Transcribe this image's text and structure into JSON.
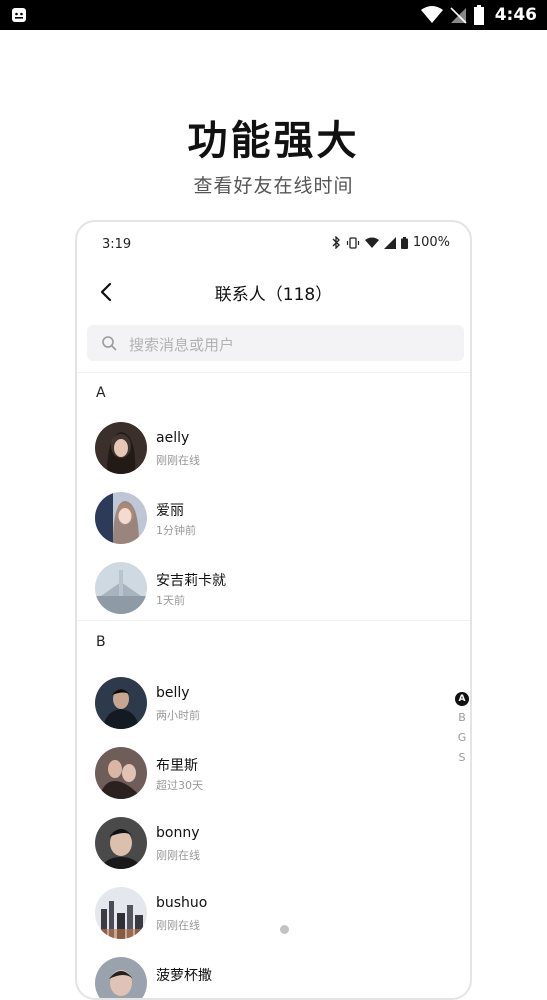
{
  "status_bar": {
    "time": "4:46",
    "icons": [
      "notification-icon",
      "wifi-icon",
      "no-signal-icon",
      "battery-icon"
    ]
  },
  "headline": "功能强大",
  "subline": "查看好友在线时间",
  "phone": {
    "status": {
      "time": "3:19",
      "battery": "100%"
    },
    "nav": {
      "title": "联系人（118）"
    },
    "search": {
      "placeholder": "搜索消息或用户"
    },
    "sections": [
      {
        "letter": "A",
        "contacts": [
          {
            "name": "aelly",
            "status": "刚刚在线"
          },
          {
            "name": "爱丽",
            "status": "1分钟前"
          },
          {
            "name": "安吉莉卡就",
            "status": "1天前"
          }
        ]
      },
      {
        "letter": "B",
        "contacts": [
          {
            "name": "belly",
            "status": "两小时前"
          },
          {
            "name": "布里斯",
            "status": "超过30天"
          },
          {
            "name": "bonny",
            "status": "刚刚在线"
          },
          {
            "name": "bushuo",
            "status": "刚刚在线"
          },
          {
            "name": "菠萝杯撒",
            "status": ""
          }
        ]
      }
    ],
    "index": [
      "A",
      "B",
      "G",
      "S"
    ]
  }
}
